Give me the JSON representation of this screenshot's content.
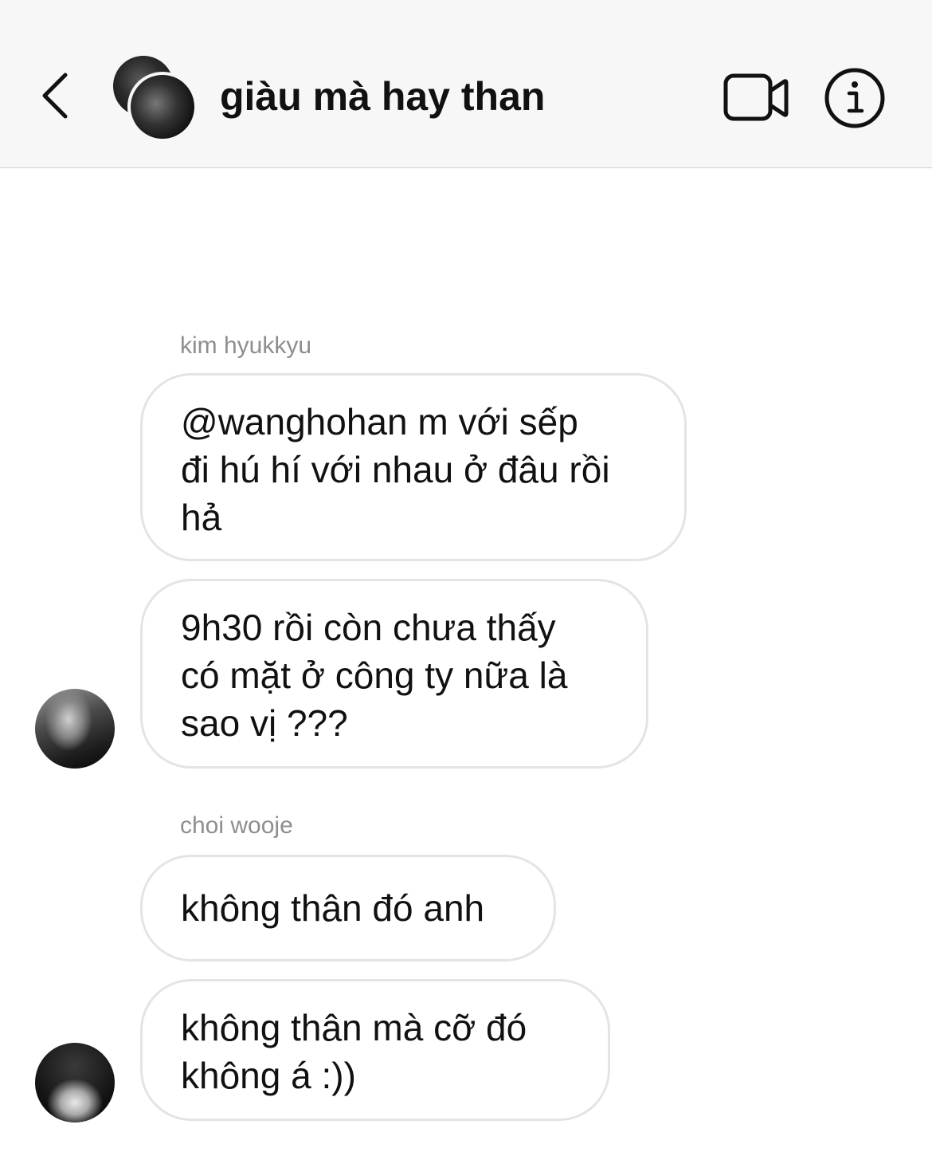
{
  "header": {
    "title": "giàu mà hay than",
    "back_icon": "chevron-left-icon",
    "video_icon": "video-camera-icon",
    "info_icon": "info-icon"
  },
  "messages": [
    {
      "sender": "kim hyukkyu",
      "bubbles": [
        {
          "lines": [
            "@wanghohan m với sếp",
            "đi hú hí với nhau ở đâu rồi",
            "hả"
          ]
        },
        {
          "lines": [
            "9h30 rồi còn chưa thấy",
            "có mặt ở công ty nữa là",
            "sao vị ???"
          ]
        }
      ]
    },
    {
      "sender": "choi wooje",
      "bubbles": [
        {
          "lines": [
            "không thân đó anh"
          ]
        },
        {
          "lines": [
            "không thân mà cỡ đó",
            "không á :))"
          ]
        }
      ]
    }
  ],
  "colors": {
    "header_bg": "#f7f7f7",
    "bubble_border": "#e4e4e4",
    "sender_text": "#8e8e8e"
  }
}
